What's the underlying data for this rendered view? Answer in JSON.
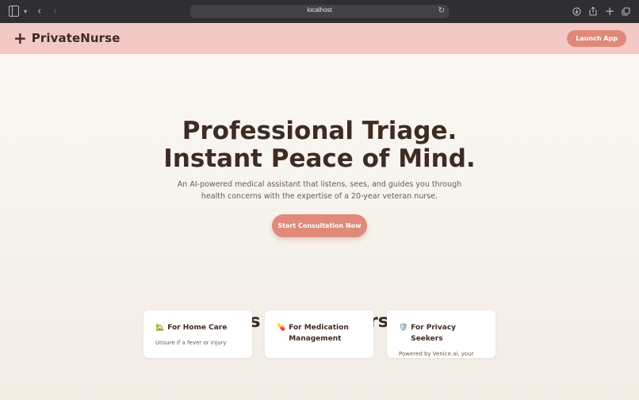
{
  "browser": {
    "url": "localhost",
    "icons": [
      "sidebar-icon",
      "chevron-down-icon",
      "back-icon",
      "forward-icon",
      "reload-icon",
      "download-icon",
      "share-icon",
      "new-tab-icon",
      "tabs-overview-icon"
    ]
  },
  "header": {
    "brand_icon": "+",
    "brand_name": "PrivateNurse",
    "launch_label": "Launch App"
  },
  "hero": {
    "title_line1": "Professional Triage.",
    "title_line2": "Instant Peace of Mind.",
    "subtitle": "An AI-powered medical assistant that listens, sees, and guides you through health concerns with the expertise of a 20-year veteran nurse.",
    "cta_label": "Start Consultation Now"
  },
  "audience": {
    "title": "Who is PrivateNurse for?",
    "cards": [
      {
        "icon": "🏡",
        "title": "For Home Care",
        "body": "Unsure if a fever or injury"
      },
      {
        "icon": "💊",
        "title": "For Medication Management",
        "body": ""
      },
      {
        "icon": "🛡️",
        "title": "For Privacy Seekers",
        "body": "Powered by Venice.ai, your"
      }
    ]
  },
  "colors": {
    "accent": "#e0897a",
    "header_bg": "#f2c9c5",
    "text": "#3e2b22"
  }
}
